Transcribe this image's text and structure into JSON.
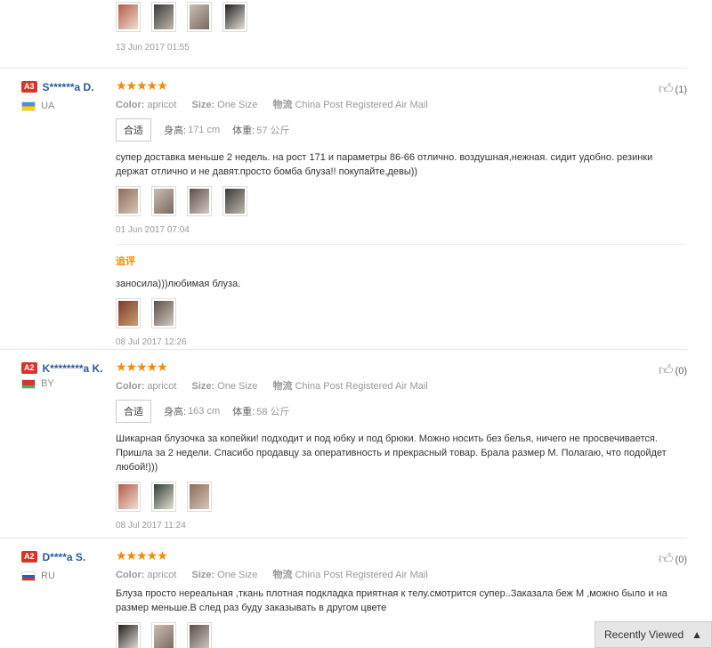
{
  "top": {
    "date": "13 Jun 2017 01:55"
  },
  "meta_labels": {
    "color": "Color:",
    "size": "Size:",
    "shipping": "物流"
  },
  "size_labels": {
    "fit": "合适",
    "height": "身高:",
    "weight": "体重:"
  },
  "reviews": [
    {
      "badge": "A3",
      "name": "S******a D.",
      "country": "UA",
      "likes": "(1)",
      "stars": "★★★★★",
      "color": "apricot",
      "size": "One Size",
      "shipping": "China Post Registered Air Mail",
      "height": "171 cm",
      "weight": "57 公斤",
      "text": "супер доставка меньше 2 недель. на рост 171 и параметры 86-66 отлично. воздушная,нежная. сидит удобно. резинки держат отлично и не давят.просто бомба блуза!! покупайте,девы))",
      "date": "01 Jun 2017 07:04",
      "additional_title": "追评",
      "additional_text": "заносила)))любимая блуза.",
      "additional_date": "08 Jul 2017 12:26"
    },
    {
      "badge": "A2",
      "name": "K********a K.",
      "country": "BY",
      "likes": "(0)",
      "stars": "★★★★★",
      "color": "apricot",
      "size": "One Size",
      "shipping": "China Post Registered Air Mail",
      "height": "163 cm",
      "weight": "58 公斤",
      "text": "Шикарная блузочка за копейки! подходит и под юбку и под брюки. Можно носить без белья, ничего не просвечивается. Пришла за 2 недели. Спасибо продавцу за оперативность и прекрасный товар. Брала размер М. Полагаю, что подойдет любой!)))",
      "date": "08 Jul 2017 11:24"
    },
    {
      "badge": "A2",
      "name": "D****a S.",
      "country": "RU",
      "likes": "(0)",
      "stars": "★★★★★",
      "color": "apricot",
      "size": "One Size",
      "shipping": "China Post Registered Air Mail",
      "text": "Блуза просто нереальная ,ткань плотная подкладка приятная к телу.смотрится супер..Заказала беж М ,можно было и на размер меньше.В след раз буду заказывать в другом цвете"
    }
  ],
  "recently_viewed": "Recently Viewed",
  "icons": {
    "like": "thumbs-up-icon",
    "recent_arrow": "chevron-up-icon"
  },
  "colors": {
    "accent": "#f68a00",
    "username": "#2b5b9a",
    "badge": "#d9342b"
  }
}
